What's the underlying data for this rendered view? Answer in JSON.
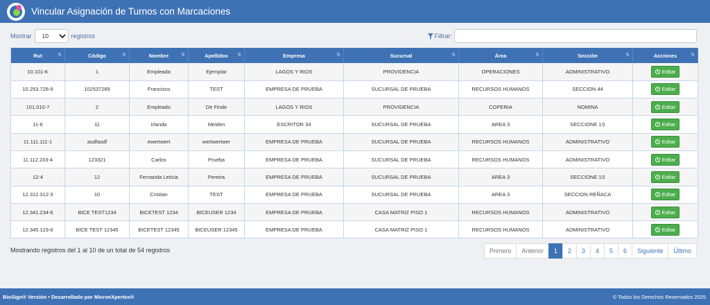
{
  "header": {
    "title": "Vincular Asignación de Turnos con Marcaciones"
  },
  "controls": {
    "show_label": "Mostrar",
    "page_length": "10",
    "records_label": "registros",
    "filter_label": "Filtrar:",
    "filter_value": ""
  },
  "table": {
    "columns": [
      "Rut",
      "Código",
      "Nombre",
      "Apellidos",
      "Empresa",
      "Sucursal",
      "Área",
      "Sección",
      "Acciones"
    ],
    "rows": [
      [
        "10.101-K",
        "1",
        "Empleada",
        "Ejemplar",
        "LAGOS Y RIOS",
        "PROVIDENCIA",
        "OPERACIONES",
        "ADMINISTRATIVO"
      ],
      [
        "10.253.728-9",
        "102537289",
        "Francisco",
        "TEST",
        "EMPRESA DE PRUEBA",
        "SUCURSAL DE PRUEBA",
        "RECURSOS HUMANOS",
        "SECCION 44"
      ],
      [
        "101.010-7",
        "2",
        "Empleado",
        "De Finde",
        "LAGOS Y RIOS",
        "PROVIDENCIA",
        "COPERIA",
        "NOMINA"
      ],
      [
        "11-6",
        "11",
        "Irlanda",
        "Meiden",
        "ESCRITOR 34",
        "SUCURSAL DE PRUEBA",
        "AREA 3",
        "SECCIONE 1S"
      ],
      [
        "11.111.111-1",
        "asdfasdf",
        "ewertwert",
        "wertwertwer",
        "EMPRESA DE PRUEBA",
        "SUCURSAL DE PRUEBA",
        "RECURSOS HUMANOS",
        "ADMINISTRATIVO"
      ],
      [
        "11.112.233-4",
        "123321",
        "Carlos",
        "Prueba",
        "EMPRESA DE PRUEBA",
        "SUCURSAL DE PRUEBA",
        "RECURSOS HUMANOS",
        "ADMINISTRATIVO"
      ],
      [
        "12-4",
        "12",
        "Fernanda Leticia",
        "Pereira",
        "EMPRESA DE PRUEBA",
        "SUCURSAL DE PRUEBA",
        "AREA 3",
        "SECCIONE 1S"
      ],
      [
        "12.312.312-3",
        "10",
        "Cristian",
        "TEST",
        "EMPRESA DE PRUEBA",
        "SUCURSAL DE PRUEBA",
        "AREA 3",
        "SECCION REÑACA"
      ],
      [
        "12.341.234-6",
        "BICE TEST1234",
        "BICETEST 1234",
        "BICEUSER 1234",
        "EMPRESA DE PRUEBA",
        "CASA MATRIZ PISO 1",
        "RECURSOS HUMANOS",
        "ADMINISTRATIVO"
      ],
      [
        "12.345.123-6",
        "BICE TEST 12345",
        "BICETEST 12345",
        "BICEUSER 12345",
        "EMPRESA DE PRUEBA",
        "CASA MATRIZ PISO 1",
        "RECURSOS HUMANOS",
        "ADMINISTRATIVO"
      ]
    ],
    "action_label": "Editar"
  },
  "info": "Mostrando registros del 1 al 10 de un total de 54 registros",
  "pagination": {
    "first": "Primero",
    "previous": "Anterior",
    "pages": [
      "1",
      "2",
      "3",
      "4",
      "5",
      "6"
    ],
    "active_page": "1",
    "next": "Siguiente",
    "last": "Último"
  },
  "footer": {
    "left": "BioSign® Versión • Desarrollado por MicroeXpertos®",
    "right": "© Todos los Derechos Reservados 2025"
  },
  "colors": {
    "primary": "#3f72b5",
    "success": "#4cae4c",
    "background": "#eef0f3"
  }
}
